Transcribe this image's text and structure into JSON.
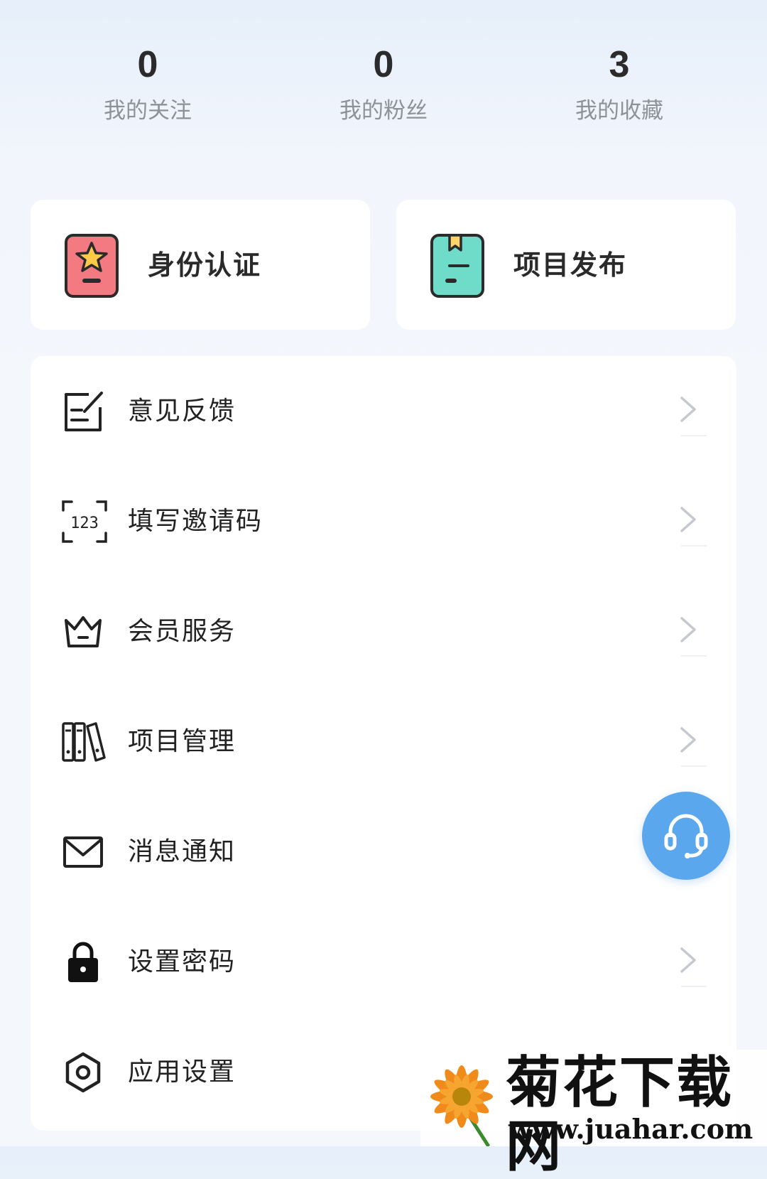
{
  "stats": [
    {
      "value": "0",
      "label": "我的关注"
    },
    {
      "value": "0",
      "label": "我的粉丝"
    },
    {
      "value": "3",
      "label": "我的收藏"
    }
  ],
  "quick_actions": [
    {
      "label": "身份认证",
      "icon": "id-badge-star-icon",
      "color": "#f27a80"
    },
    {
      "label": "项目发布",
      "icon": "bookmark-book-icon",
      "color": "#6fdcc9"
    }
  ],
  "menu": [
    {
      "label": "意见反馈",
      "icon": "feedback-edit-icon",
      "has_arrow": true
    },
    {
      "label": "填写邀请码",
      "icon": "invite-code-icon",
      "icon_text": "123",
      "has_arrow": true
    },
    {
      "label": "会员服务",
      "icon": "crown-icon",
      "has_arrow": true
    },
    {
      "label": "项目管理",
      "icon": "binders-icon",
      "has_arrow": true
    },
    {
      "label": "消息通知",
      "icon": "envelope-icon",
      "has_arrow": false
    },
    {
      "label": "设置密码",
      "icon": "lock-icon",
      "has_arrow": true
    },
    {
      "label": "应用设置",
      "icon": "hex-settings-icon",
      "has_arrow": false
    }
  ],
  "fab": {
    "icon": "headset-icon",
    "color": "#5aa7ee"
  },
  "watermark": {
    "title": "菊花下载网",
    "url": "www.juahar.com"
  }
}
